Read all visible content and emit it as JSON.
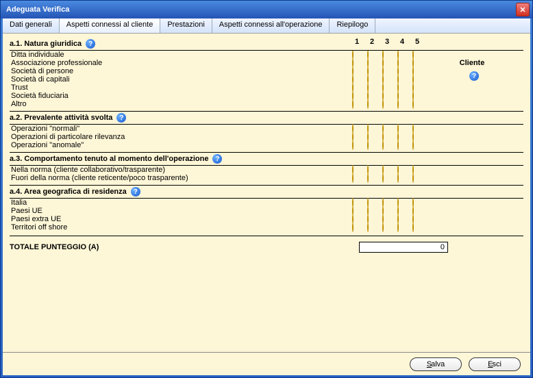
{
  "window": {
    "title": "Adeguata Verifica"
  },
  "tabs": [
    "Dati generali",
    "Aspetti connessi al cliente",
    "Prestazioni",
    "Aspetti connessi all'operazione",
    "Riepilogo"
  ],
  "active_tab": 1,
  "score_columns": [
    "1",
    "2",
    "3",
    "4",
    "5"
  ],
  "side_panel": {
    "label": "Cliente"
  },
  "sections": [
    {
      "id": "a1",
      "title": "a.1. Natura giuridica",
      "rows": [
        "Ditta individuale",
        "Associazione professionale",
        "Società di persone",
        "Società di capitali",
        "Trust",
        "Società fiduciaria",
        "Altro"
      ]
    },
    {
      "id": "a2",
      "title": "a.2. Prevalente attività svolta",
      "rows": [
        "Operazioni \"normali\"",
        "Operazioni di particolare rilevanza",
        "Operazioni \"anomale\""
      ]
    },
    {
      "id": "a3",
      "title": "a.3. Comportamento tenuto al momento dell'operazione",
      "rows": [
        "Nella norma (cliente collaborativo/trasparente)",
        "Fuori della norma (cliente reticente/poco trasparente)"
      ]
    },
    {
      "id": "a4",
      "title": "a.4. Area geografica di residenza",
      "rows": [
        "Italia",
        "Paesi UE",
        "Paesi extra UE",
        "Territori off shore"
      ]
    }
  ],
  "total": {
    "label": "TOTALE PUNTEGGIO (A)",
    "value": "0"
  },
  "buttons": {
    "save": "Salva",
    "exit": "Esci"
  }
}
